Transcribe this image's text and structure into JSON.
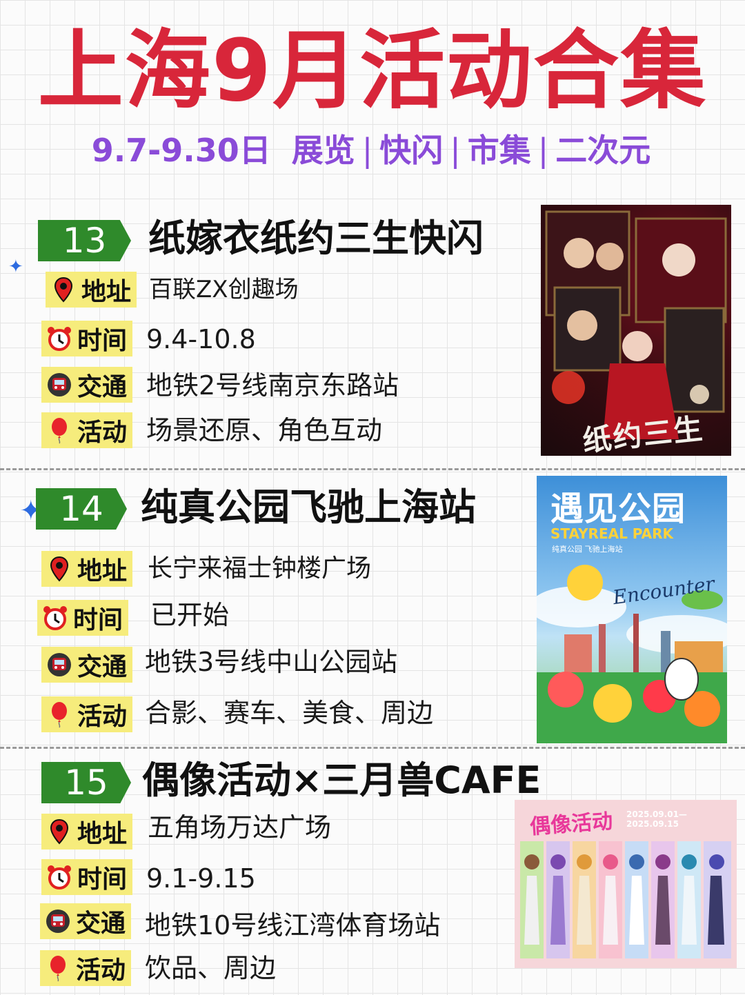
{
  "header": {
    "title": "上海9月活动合集",
    "dates": "9.7-9.30日",
    "tags": [
      "展览",
      "快闪",
      "市集",
      "二次元"
    ],
    "separator": "|"
  },
  "labels": {
    "address": "地址",
    "time": "时间",
    "transit": "交通",
    "activity": "活动"
  },
  "events": [
    {
      "number": "13",
      "title": "纸嫁衣纸约三生快闪",
      "address": "百联ZX创趣场",
      "time": "9.4-10.8",
      "transit": "地铁2号线南京东路站",
      "activity": "场景还原、角色互动",
      "poster_text": "纸约三生"
    },
    {
      "number": "14",
      "title": "纯真公园飞驰上海站",
      "address": "长宁来福士钟楼广场",
      "time": "已开始",
      "transit": "地铁3号线中山公园站",
      "activity": "合影、赛车、美食、周边",
      "poster_text": "遇见公园",
      "poster_sub": "STAYREAL PARK",
      "poster_line": "纯真公园 飞驰上海站",
      "poster_script": "Encounter"
    },
    {
      "number": "15",
      "title": "偶像活动×三月兽CAFE",
      "address": "五角场万达广场",
      "time": "9.1-9.15",
      "transit": "地铁10号线江湾体育场站",
      "activity": "饮品、周边",
      "poster_text": "偶像活动",
      "poster_dates": "2025.09.01—2025.09.15"
    }
  ],
  "colors": {
    "title": "#d8263a",
    "subtitle": "#8a4bd8",
    "badge": "#2f8a2b",
    "label_bg": "#f6ec7c"
  },
  "icons": [
    "location-pin-icon",
    "alarm-clock-icon",
    "metro-train-icon",
    "balloon-icon",
    "sparkle-star-icon"
  ]
}
